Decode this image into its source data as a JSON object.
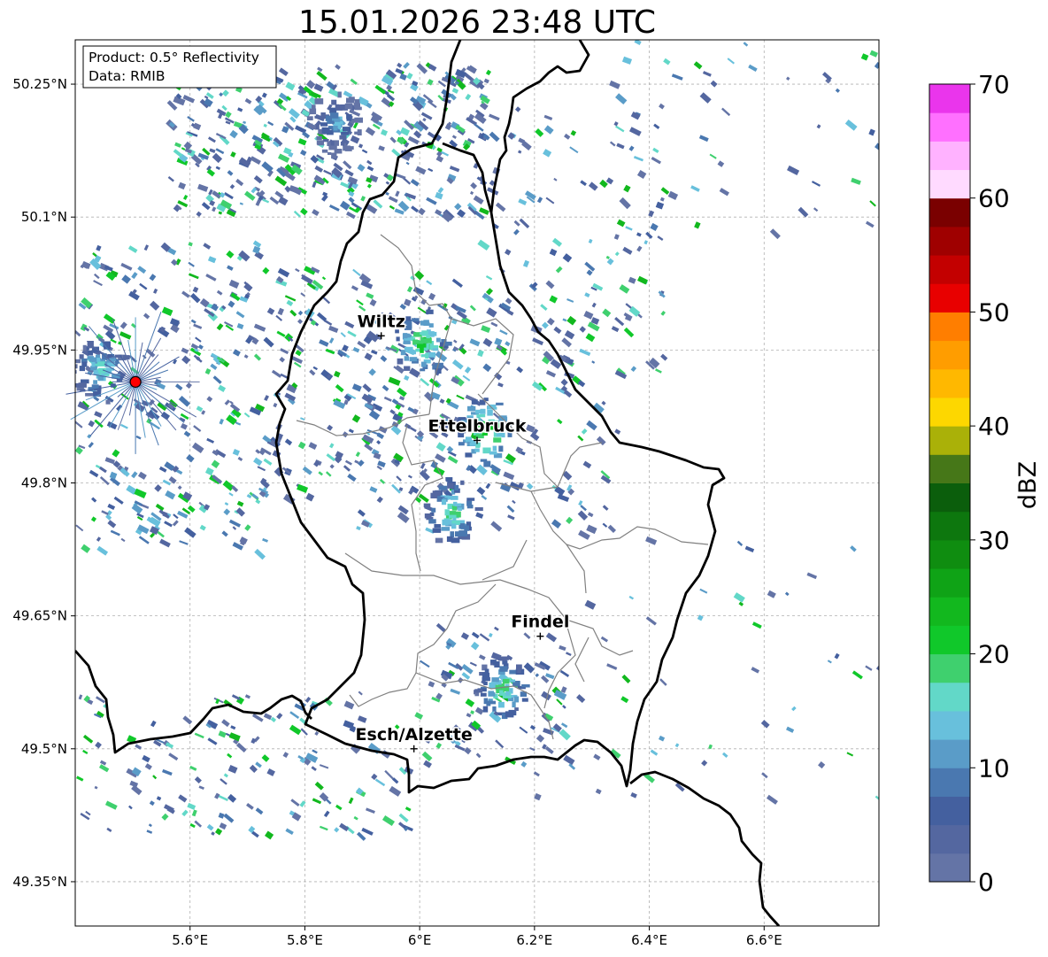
{
  "title": "15.01.2026 23:48 UTC",
  "info_box": {
    "line1": "Product: 0.5° Reflectivity",
    "line2": "Data: RMIB"
  },
  "axes": {
    "lon_range": [
      5.4,
      6.8
    ],
    "lat_range": [
      49.3,
      50.3
    ],
    "lon_ticks": [
      5.6,
      5.8,
      6.0,
      6.2,
      6.4,
      6.6
    ],
    "lon_tick_labels": [
      "5.6°E",
      "5.8°E",
      "6°E",
      "6.2°E",
      "6.4°E",
      "6.6°E"
    ],
    "lat_ticks": [
      49.35,
      49.5,
      49.65,
      49.8,
      49.95,
      50.1,
      50.25
    ],
    "lat_tick_labels": [
      "49.35°N",
      "49.5°N",
      "49.65°N",
      "49.8°N",
      "49.95°N",
      "50.1°N",
      "50.25°N"
    ],
    "grid": true
  },
  "cities": [
    {
      "name": "Wiltz",
      "lon": 5.933,
      "lat": 49.966
    },
    {
      "name": "Ettelbruck",
      "lon": 6.1,
      "lat": 49.848
    },
    {
      "name": "Findel",
      "lon": 6.21,
      "lat": 49.627
    },
    {
      "name": "Esch/Alzette",
      "lon": 5.99,
      "lat": 49.5
    }
  ],
  "radar_site": {
    "lon": 5.505,
    "lat": 49.914,
    "color": "#ff0000"
  },
  "colorbar": {
    "label": "dBZ",
    "min": 0,
    "max": 70,
    "step": 2.5,
    "tick_values": [
      0,
      10,
      20,
      30,
      40,
      50,
      60,
      70
    ],
    "tick_labels": [
      "0",
      "10",
      "20",
      "30",
      "40",
      "50",
      "60",
      "70"
    ],
    "colors": [
      "#6474a6",
      "#5467a0",
      "#44609f",
      "#4a78b0",
      "#5a9cc8",
      "#68c0dc",
      "#62d8c8",
      "#3fd06e",
      "#10c82a",
      "#12b81e",
      "#0fa316",
      "#0f8d10",
      "#0d770e",
      "#0b5e0c",
      "#467718",
      "#aab108",
      "#fdd700",
      "#ffb800",
      "#ff9d00",
      "#ff7e00",
      "#e80000",
      "#c30000",
      "#9f0000",
      "#7a0000",
      "#ffdaff",
      "#ffb2ff",
      "#ff70ff",
      "#ea35ec"
    ]
  },
  "reflectivity_cells": [
    {
      "lon": 6.0,
      "lat": 49.96,
      "dbz": 22
    },
    {
      "lon": 6.11,
      "lat": 49.86,
      "dbz": 24
    },
    {
      "lon": 6.05,
      "lat": 49.77,
      "dbz": 20
    },
    {
      "lon": 6.14,
      "lat": 49.57,
      "dbz": 20
    },
    {
      "lon": 5.85,
      "lat": 50.21,
      "dbz": 14
    },
    {
      "lon": 5.44,
      "lat": 49.93,
      "dbz": 18
    }
  ]
}
